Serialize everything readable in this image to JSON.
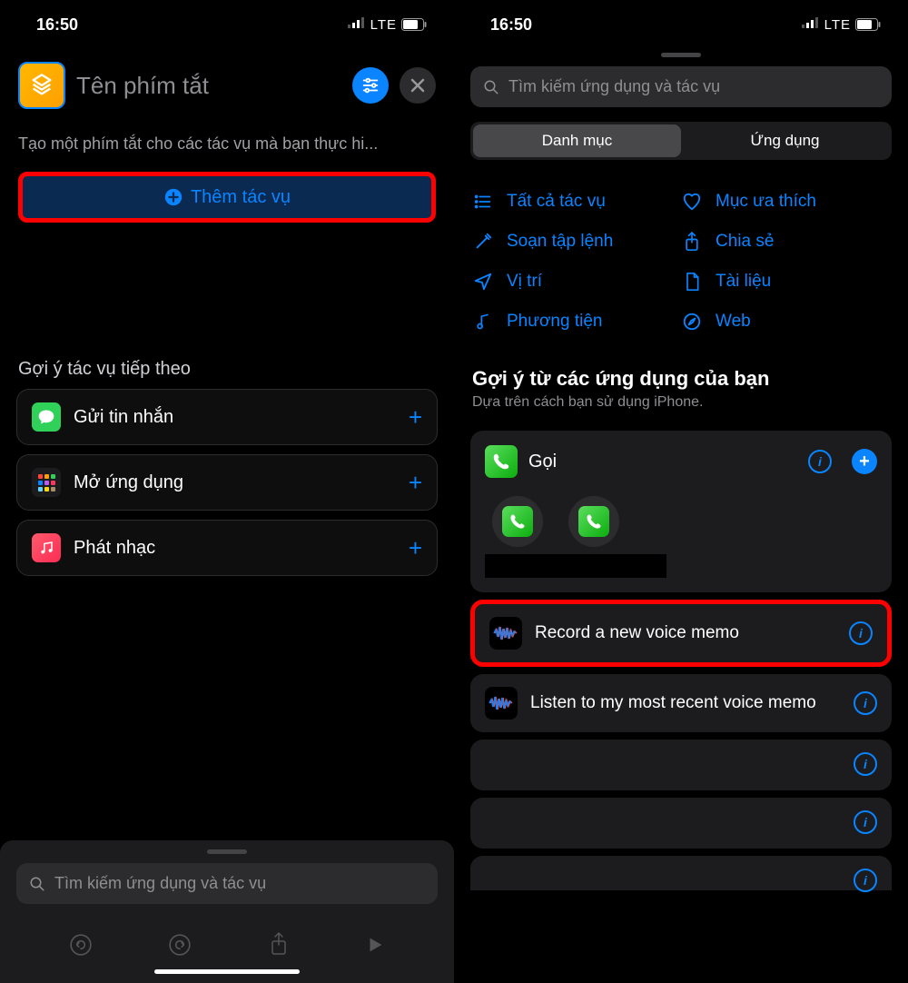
{
  "status": {
    "time": "16:50",
    "network": "LTE"
  },
  "left": {
    "title_placeholder": "Tên phím tắt",
    "description": "Tạo một phím tắt cho các tác vụ mà bạn thực hi...",
    "add_action": "Thêm tác vụ",
    "next_actions_title": "Gợi ý tác vụ tiếp theo",
    "suggestions": [
      {
        "label": "Gửi tin nhắn"
      },
      {
        "label": "Mở ứng dụng"
      },
      {
        "label": "Phát nhạc"
      }
    ],
    "search_placeholder": "Tìm kiếm ứng dụng và tác vụ"
  },
  "right": {
    "search_placeholder": "Tìm kiếm ứng dụng và tác vụ",
    "segments": {
      "categories": "Danh mục",
      "apps": "Ứng dụng"
    },
    "categories": [
      {
        "label": "Tất cả tác vụ"
      },
      {
        "label": "Mục ưa thích"
      },
      {
        "label": "Soạn tập lệnh"
      },
      {
        "label": "Chia sẻ"
      },
      {
        "label": "Vị trí"
      },
      {
        "label": "Tài liệu"
      },
      {
        "label": "Phương tiện"
      },
      {
        "label": "Web"
      }
    ],
    "apps_section_title": "Gợi ý từ các ứng dụng của bạn",
    "apps_subtitle": "Dựa trên cách bạn sử dụng iPhone.",
    "call_card_title": "Gọi",
    "voice_items": [
      {
        "label": "Record a new voice memo"
      },
      {
        "label": "Listen to my most recent voice memo"
      }
    ]
  }
}
